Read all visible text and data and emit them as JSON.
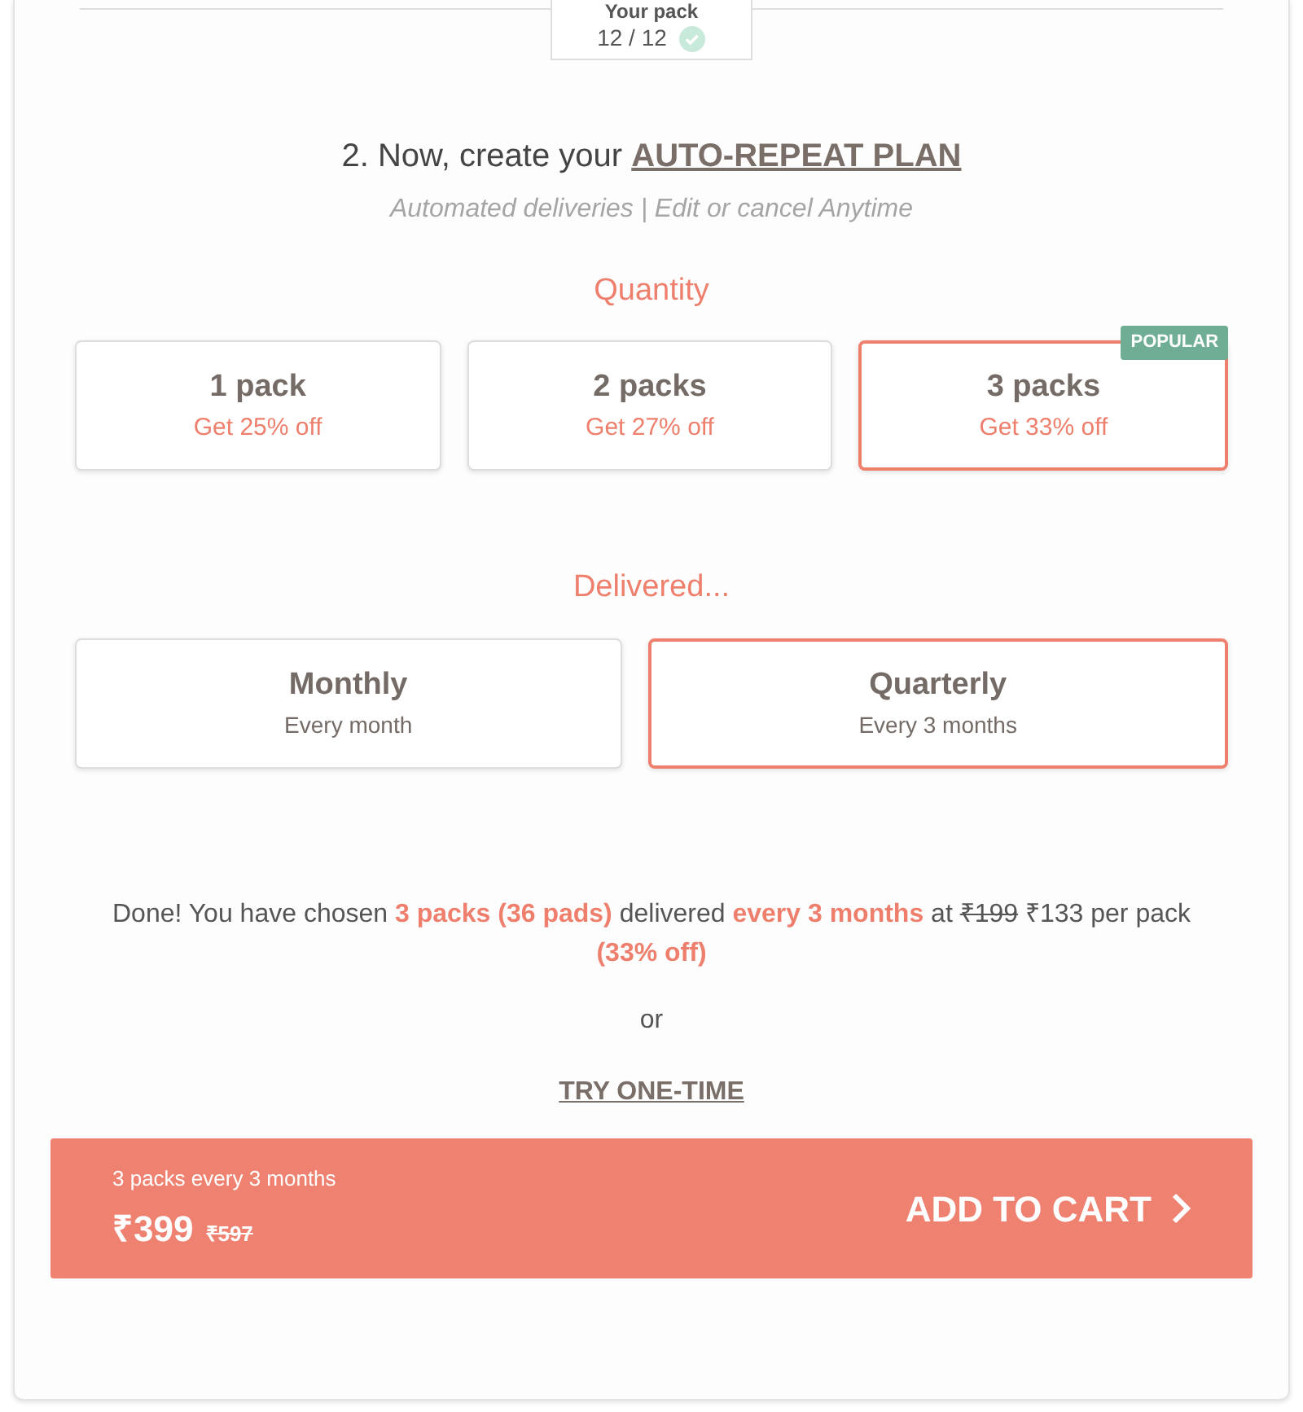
{
  "pack_status": {
    "label": "Your pack",
    "count": "12 / 12",
    "complete": true
  },
  "heading": {
    "prefix": "2. Now, create your",
    "link": "AUTO-REPEAT PLAN"
  },
  "subheading": "Automated deliveries | Edit or cancel Anytime",
  "quantity": {
    "title": "Quantity",
    "options": [
      {
        "label": "1 pack",
        "offer": "Get 25% off",
        "selected": false
      },
      {
        "label": "2 packs",
        "offer": "Get 27% off",
        "selected": false
      },
      {
        "label": "3 packs",
        "offer": "Get 33% off",
        "selected": true,
        "badge": "POPULAR"
      }
    ]
  },
  "frequency": {
    "title": "Delivered...",
    "options": [
      {
        "label": "Monthly",
        "detail": "Every month",
        "selected": false
      },
      {
        "label": "Quarterly",
        "detail": "Every 3 months",
        "selected": true
      }
    ]
  },
  "summary": [
    {
      "kind": "plain",
      "text": "Done! You have chosen "
    },
    {
      "kind": "accent",
      "text": "3 packs (36 pads)"
    },
    {
      "kind": "plain",
      "text": " delivered "
    },
    {
      "kind": "accent",
      "text": "every 3 months"
    },
    {
      "kind": "plain",
      "text": " at "
    },
    {
      "kind": "strike",
      "text": "₹199"
    },
    {
      "kind": "plain",
      "text": " ₹133 per pack "
    },
    {
      "kind": "accent",
      "text": "(33% off)"
    }
  ],
  "separator": "or",
  "one_time_link": "TRY ONE-TIME",
  "cart_bar": {
    "plan": "3 packs every 3 months",
    "price": "₹399",
    "old_price": "₹597",
    "action": "ADD TO CART"
  }
}
